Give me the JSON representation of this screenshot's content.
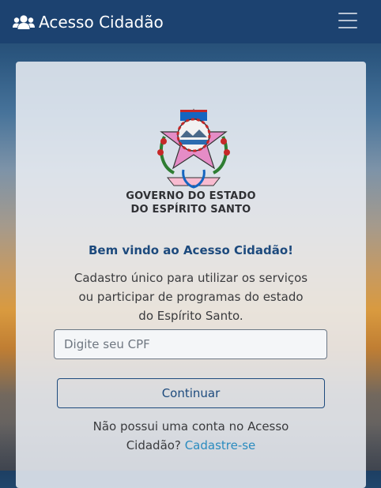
{
  "navbar": {
    "brand_icon": "users-icon",
    "brand_name": "Acesso Cidadão",
    "menu_icon": "hamburger-menu-icon"
  },
  "card": {
    "logo": {
      "icon": "espirito-santo-coat-of-arms"
    },
    "org_name_line1": "GOVERNO DO ESTADO",
    "org_name_line2": "DO ESPÍRITO SANTO",
    "welcome": "Bem vindo ao Acesso Cidadão!",
    "description_lines": [
      "Cadastro único para utilizar os serviços",
      "ou participar de programas do estado",
      "do Espírito Santo."
    ],
    "cpf_placeholder": "Digite seu CPF",
    "continue_label": "Continuar",
    "signup_text": "Não possui uma conta no Acesso",
    "signup_text_2": "Cidadão?",
    "signup_link": "Cadastre-se"
  },
  "colors": {
    "navbar": "#1c4270",
    "primary": "#1d4a7d",
    "link": "#2a8bbf"
  }
}
